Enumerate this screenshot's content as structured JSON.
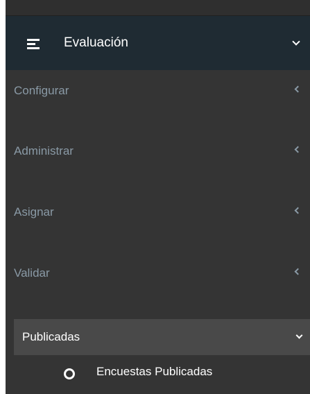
{
  "header": {
    "title": "Evaluación",
    "icon": "menu-icon",
    "expand_icon": "chevron-down-icon"
  },
  "menu": {
    "items": [
      {
        "label": "Configurar",
        "icon": "chevron-left-icon"
      },
      {
        "label": "Administrar",
        "icon": "chevron-left-icon"
      },
      {
        "label": "Asignar",
        "icon": "chevron-left-icon"
      },
      {
        "label": "Validar",
        "icon": "chevron-left-icon"
      }
    ],
    "active": {
      "label": "Publicadas",
      "icon": "chevron-down-icon"
    },
    "submenu": {
      "label": "Encuestas Publicadas",
      "icon": "circle-icon"
    }
  },
  "colors": {
    "sidebar_bg": "#343434",
    "header_bg": "#1f2b33",
    "active_bg": "#494949",
    "inactive_text": "#8a9aa6",
    "active_text": "#ffffff"
  }
}
